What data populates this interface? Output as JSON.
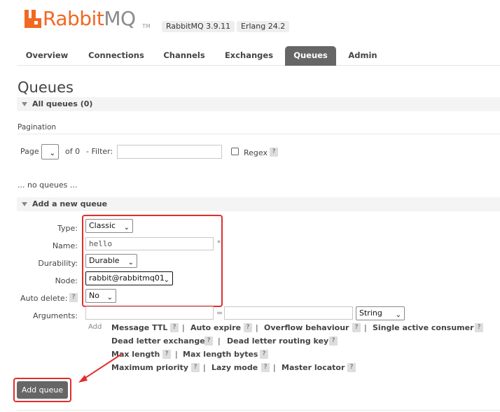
{
  "header": {
    "logo_text_a": "Rabbit",
    "logo_text_b": "MQ",
    "logo_tm": "TM",
    "version": "RabbitMQ 3.9.11",
    "erlang": "Erlang 24.2"
  },
  "tabs": [
    "Overview",
    "Connections",
    "Channels",
    "Exchanges",
    "Queues",
    "Admin"
  ],
  "active_tab": "Queues",
  "page_title": "Queues",
  "all_queues": "All queues (0)",
  "pagination": {
    "heading": "Pagination",
    "page_label": "Page",
    "of_label": "of 0",
    "filter_label": "- Filter:",
    "regex_label": "Regex",
    "help": "?"
  },
  "no_queues": "... no queues ...",
  "add_section": "Add a new queue",
  "form": {
    "type_label": "Type:",
    "type_value": "Classic",
    "name_label": "Name:",
    "name_value": "hello",
    "required_mark": "*",
    "durability_label": "Durability:",
    "durability_value": "Durable",
    "node_label": "Node:",
    "node_value": "rabbit@rabbitmq01",
    "auto_delete_label": "Auto delete:",
    "auto_delete_help": "?",
    "auto_delete_value": "No",
    "arguments_label": "Arguments:",
    "arguments_eq": "=",
    "arguments_type": "String",
    "add_label": "Add"
  },
  "arg_links": {
    "row1": [
      "Message TTL",
      "Auto expire",
      "Overflow behaviour",
      "Single active consumer"
    ],
    "row2": [
      "Dead letter exchange",
      "Dead letter routing key"
    ],
    "row3": [
      "Max length",
      "Max length bytes"
    ],
    "row4": [
      "Maximum priority",
      "Lazy mode",
      "Master locator"
    ],
    "help": "?",
    "sep": "|"
  },
  "add_button": "Add queue",
  "colors": {
    "brand_orange": "#f26822",
    "tab_active": "#666666",
    "annotation_red": "#e12d2d"
  }
}
